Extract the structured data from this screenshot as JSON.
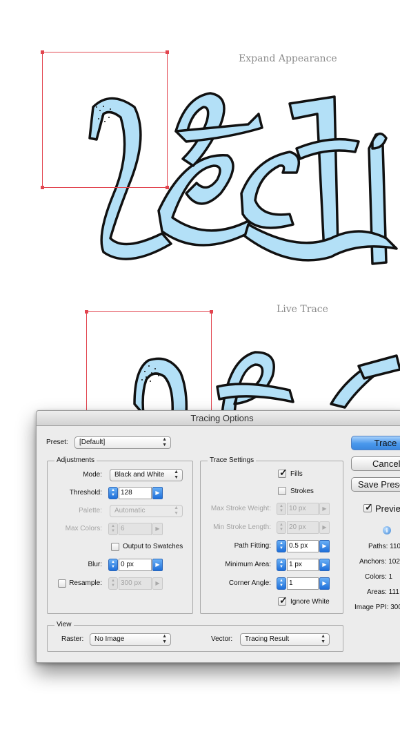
{
  "captions": {
    "top": "Expand Appearance",
    "bottom": "Live Trace"
  },
  "dialog": {
    "title": "Tracing Options",
    "preset": {
      "label": "Preset:",
      "value": "[Default]"
    },
    "adjustments": {
      "title": "Adjustments",
      "mode": {
        "label": "Mode:",
        "value": "Black and White"
      },
      "threshold": {
        "label": "Threshold:",
        "value": "128"
      },
      "palette": {
        "label": "Palette:",
        "value": "Automatic"
      },
      "max_colors": {
        "label": "Max Colors:",
        "value": "6"
      },
      "output_to_swatches": {
        "label": "Output to Swatches",
        "checked": false
      },
      "blur": {
        "label": "Blur:",
        "value": "0 px"
      },
      "resample": {
        "label": "Resample:",
        "value": "300 px",
        "checked": false
      }
    },
    "trace_settings": {
      "title": "Trace Settings",
      "fills": {
        "label": "Fills",
        "checked": true
      },
      "strokes": {
        "label": "Strokes",
        "checked": false
      },
      "max_stroke_weight": {
        "label": "Max Stroke Weight:",
        "value": "10 px"
      },
      "min_stroke_length": {
        "label": "Min Stroke Length:",
        "value": "20 px"
      },
      "path_fitting": {
        "label": "Path Fitting:",
        "value": "0.5 px"
      },
      "minimum_area": {
        "label": "Minimum Area:",
        "value": "1 px"
      },
      "corner_angle": {
        "label": "Corner Angle:",
        "value": "1"
      },
      "ignore_white": {
        "label": "Ignore White",
        "checked": true
      }
    },
    "view": {
      "title": "View",
      "raster": {
        "label": "Raster:",
        "value": "No Image"
      },
      "vector": {
        "label": "Vector:",
        "value": "Tracing Result"
      }
    },
    "buttons": {
      "trace": "Trace",
      "cancel": "Cancel",
      "save_preset": "Save Preset"
    },
    "preview": {
      "label": "Preview",
      "checked": true
    },
    "stats": {
      "paths": "Paths: 110",
      "anchors": "Anchors: 102",
      "colors": "Colors: 1",
      "areas": "Areas: 111",
      "image_ppi": "Image PPI: 300"
    }
  },
  "colors": {
    "ribbon_fill": "#b3e0f7",
    "ribbon_stroke": "#111111",
    "selection": "#e2454f",
    "accent_blue": "#2f7fe0"
  },
  "icons": {
    "info": "info-icon",
    "step": "stepper-icon",
    "arrow": "play-arrow-icon",
    "popup": "popup-arrows-icon"
  }
}
